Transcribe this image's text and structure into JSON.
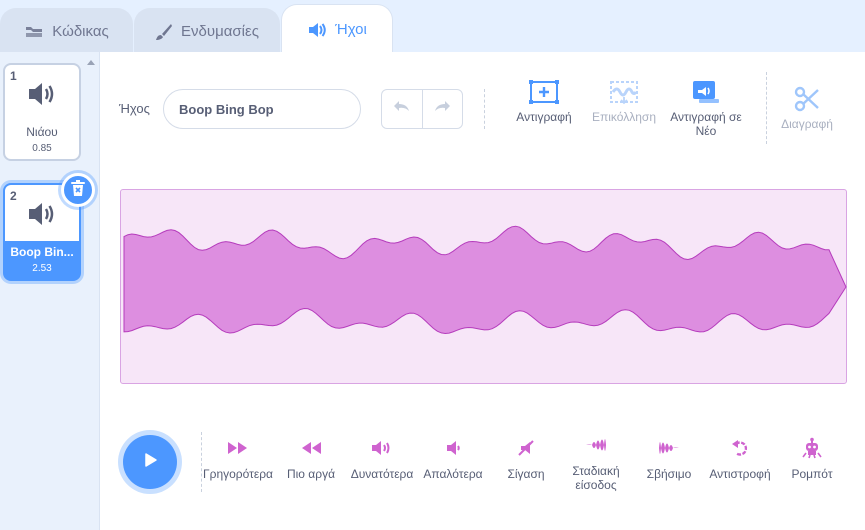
{
  "tabs": [
    {
      "label": "Κώδικας",
      "icon": "code-icon"
    },
    {
      "label": "Ενδυμασίες",
      "icon": "brush-icon"
    },
    {
      "label": "Ήχοι",
      "icon": "sound-icon"
    }
  ],
  "active_tab": "Ήχοι",
  "sounds": [
    {
      "number": "1",
      "name": "Νιάου",
      "duration": "0.85",
      "selected": false
    },
    {
      "number": "2",
      "name": "Boop Bin...",
      "duration": "2.53",
      "selected": true
    }
  ],
  "editor": {
    "name_label": "Ήχος",
    "name_value": "Boop Bing Bop",
    "tools": {
      "copy": "Αντιγραφή",
      "paste": "Επικόλληση",
      "copy_to_new": "Αντιγραφή σε Νέο",
      "delete": "Διαγραφή"
    }
  },
  "effects": {
    "faster": "Γρηγορότερα",
    "slower": "Πιο αργά",
    "louder": "Δυνατότερα",
    "softer": "Απαλότερα",
    "mute": "Σίγαση",
    "fade_in": "Σταδιακή είσοδος",
    "fade_out": "Σβήσιμο",
    "reverse": "Αντιστροφή",
    "robot": "Ρομπότ"
  },
  "colors": {
    "accent": "#4c97ff",
    "waveform_fill": "#dd8ee0",
    "waveform_stroke": "#b53cbc",
    "effect_icon": "#cf63cf"
  }
}
